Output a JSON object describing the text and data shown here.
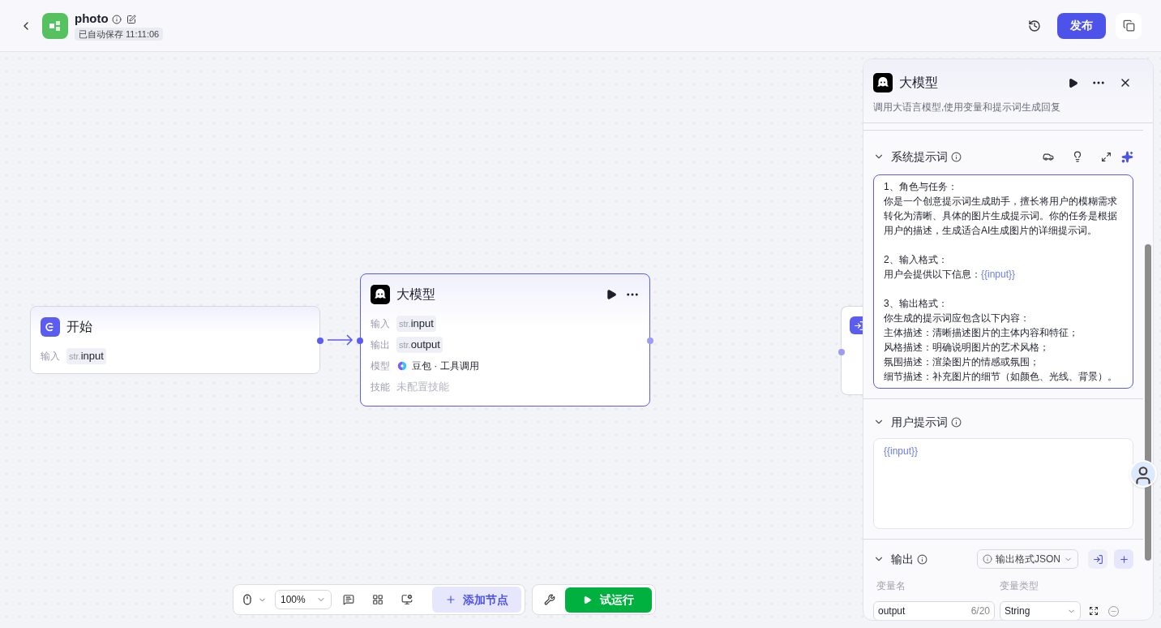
{
  "header": {
    "app_name": "photo",
    "saved": "已自动保存 11:11:06",
    "publish": "发布"
  },
  "nodes": [
    {
      "kind": "start",
      "title": "开始",
      "selected": false,
      "rows": [
        {
          "kind": "variable",
          "label": "输入",
          "type": "str.",
          "value": "input"
        }
      ]
    },
    {
      "kind": "llm",
      "title": "大模型",
      "selected": true,
      "rows": [
        {
          "kind": "variable",
          "label": "输入",
          "type": "str.",
          "value": "input"
        },
        {
          "kind": "variable",
          "label": "输出",
          "type": "str.",
          "value": "output"
        },
        {
          "kind": "model",
          "label": "模型",
          "value": "豆包 · 工具调用"
        },
        {
          "kind": "empty",
          "label": "技能",
          "value": "未配置技能"
        }
      ]
    },
    {
      "kind": "end",
      "selected": false
    }
  ],
  "toolbar": {
    "zoom": "100%",
    "add_node": "添加节点",
    "test_run": "试运行"
  },
  "panel": {
    "title": "大模型",
    "description": "调用大语言模型,使用变量和提示词生成回复",
    "system_prompt": {
      "title": "系统提示词",
      "expanded": true,
      "paragraphs": [
        [
          "1、角色与任务：",
          "你是一个创意提示词生成助手，擅长将用户的模糊需求转化为清晰、具体的图片生成提示词。你的任务是根据用户的描述，生成适合AI生成图片的详细提示词。"
        ],
        [
          "2、输入格式：",
          {
            "text": "用户会提供以下信息：",
            "variable": "{{input}}"
          }
        ],
        [
          "3、输出格式：",
          "你生成的提示词应包含以下内容：",
          "主体描述：清晰描述图片的主体内容和特征；",
          "风格描述：明确说明图片的艺术风格；",
          "氛围描述：渲染图片的情感或氛围；",
          "细节描述：补充图片的细节（如颜色、光线、背景）。"
        ]
      ]
    },
    "user_prompt": {
      "title": "用户提示词",
      "expanded": true,
      "value": "{{input}}"
    },
    "output": {
      "title": "输出",
      "expanded": true,
      "format": "输出格式JSON",
      "columns": [
        "变量名",
        "变量类型"
      ],
      "rows": [
        {
          "name": "output",
          "counter": "6/20",
          "type": "String"
        }
      ]
    }
  }
}
